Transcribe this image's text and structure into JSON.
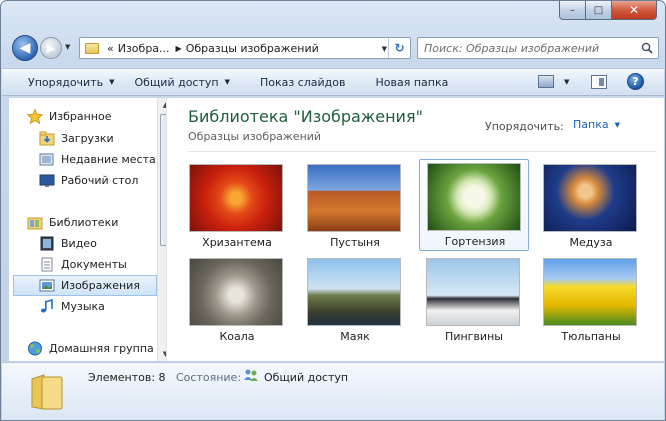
{
  "window": {
    "controls": {
      "minimize": "–",
      "maximize": "□",
      "close": "✕"
    }
  },
  "nav": {
    "back": "◀",
    "forward": "▶",
    "history_dropdown": "▼"
  },
  "address": {
    "overflow": "«",
    "crumbs": [
      "Изобра...",
      "Образцы изображений"
    ],
    "separator": "▶",
    "dropdown": "▼",
    "refresh": "↻"
  },
  "search": {
    "placeholder": "Поиск: Образцы изображений",
    "icon": "search-icon"
  },
  "toolbar": {
    "organize": "Упорядочить",
    "share": "Общий доступ",
    "slideshow": "Показ слайдов",
    "new_folder": "Новая папка",
    "dropdown_arrow": "▼",
    "help": "?"
  },
  "navpane": {
    "items": [
      {
        "label": "Избранное",
        "icon": "star-icon"
      },
      {
        "label": "Загрузки",
        "icon": "downloads-folder-icon"
      },
      {
        "label": "Недавние места",
        "icon": "recent-places-icon"
      },
      {
        "label": "Рабочий стол",
        "icon": "desktop-icon"
      },
      {
        "label": "Библиотеки",
        "icon": "libraries-icon"
      },
      {
        "label": "Видео",
        "icon": "video-icon"
      },
      {
        "label": "Документы",
        "icon": "documents-icon"
      },
      {
        "label": "Изображения",
        "icon": "pictures-icon"
      },
      {
        "label": "Музыка",
        "icon": "music-icon"
      },
      {
        "label": "Домашняя группа",
        "icon": "homegroup-icon"
      }
    ],
    "selected": "Изображения",
    "scroll_up": "▲",
    "scroll_down": "▼"
  },
  "library": {
    "title": "Библиотека \"Изображения\"",
    "subtitle": "Образцы изображений",
    "arrange_label": "Упорядочить:",
    "arrange_value": "Папка",
    "arrange_arrow": "▼"
  },
  "files": [
    {
      "name": "Хризантема",
      "icon": "chrysanthemum-photo"
    },
    {
      "name": "Пустыня",
      "icon": "desert-photo"
    },
    {
      "name": "Гортензия",
      "icon": "hydrangea-photo"
    },
    {
      "name": "Медуза",
      "icon": "jellyfish-photo"
    },
    {
      "name": "Коала",
      "icon": "koala-photo"
    },
    {
      "name": "Маяк",
      "icon": "lighthouse-photo"
    },
    {
      "name": "Пингвины",
      "icon": "penguins-photo"
    },
    {
      "name": "Тюльпаны",
      "icon": "tulips-photo"
    }
  ],
  "selected_file": "Гортензия",
  "status": {
    "count": "Элементов: 8",
    "state_label": "Состояние:",
    "state_value": "Общий доступ"
  }
}
